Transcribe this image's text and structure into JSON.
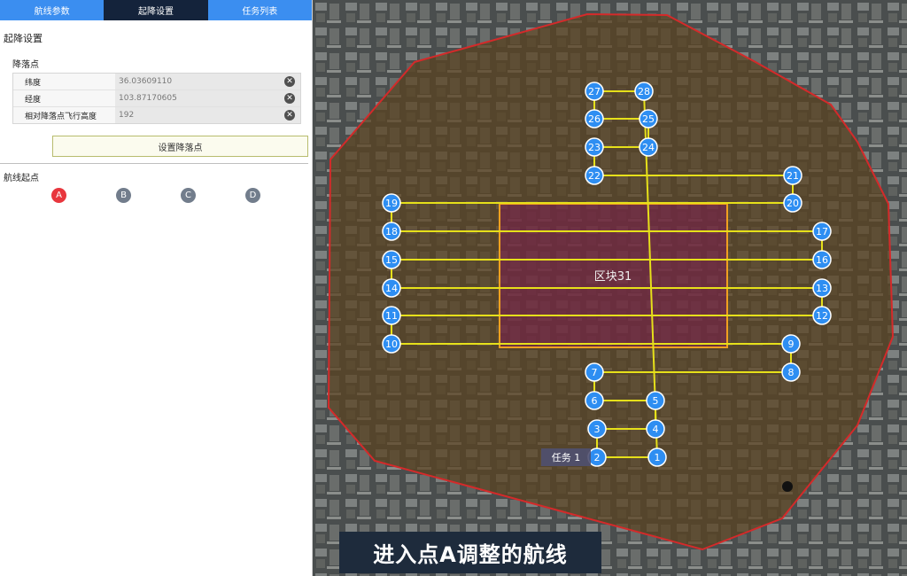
{
  "tabs": [
    {
      "label": "航线参数"
    },
    {
      "label": "起降设置"
    },
    {
      "label": "任务列表"
    }
  ],
  "landing": {
    "section_title": "起降设置",
    "subsection_title": "降落点",
    "fields": [
      {
        "label": "纬度",
        "value": "36.03609110"
      },
      {
        "label": "经度",
        "value": "103.87170605"
      },
      {
        "label": "相对降落点飞行高度",
        "value": "192"
      }
    ],
    "set_button": "设置降落点",
    "start_title": "航线起点",
    "start_points": [
      "A",
      "B",
      "C",
      "D"
    ],
    "selected_start": "A"
  },
  "map": {
    "block_label": "区块31",
    "task_label": "任务 1",
    "waypoint_labels": [
      "1",
      "2",
      "3",
      "4",
      "5",
      "6",
      "7",
      "8",
      "9",
      "10",
      "11",
      "12",
      "13",
      "14",
      "15",
      "16",
      "17",
      "18",
      "19",
      "20",
      "21",
      "22",
      "23",
      "24",
      "25",
      "26",
      "27",
      "28"
    ],
    "colors": {
      "boundary": "#d42a2a",
      "route": "#e6e01a",
      "waypoint": "#2e8ef2",
      "block_border": "#f0a020",
      "block_fill": "#7b1c4e"
    }
  },
  "caption": "进入点A调整的航线"
}
